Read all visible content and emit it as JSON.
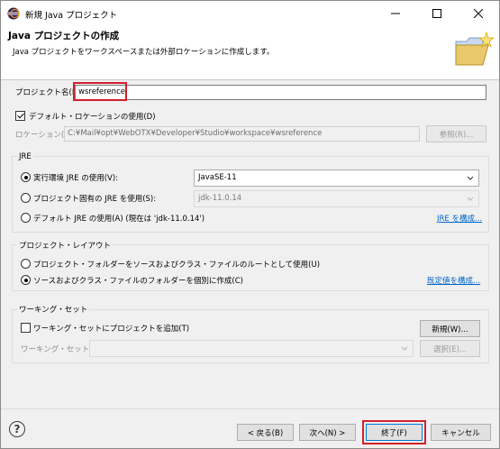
{
  "window": {
    "title": "新規 Java プロジェクト",
    "min_label": "—",
    "max_label": "☐",
    "close_label": "✕"
  },
  "header": {
    "title": "Java プロジェクトの作成",
    "description": "Java プロジェクトをワークスペースまたは外部ロケーションに作成します。"
  },
  "project": {
    "name_label": "プロジェクト名(P):",
    "name_value": "wsreference"
  },
  "location": {
    "default_label": "デフォルト・ロケーションの使用(D)",
    "default_checked": true,
    "location_label": "ロケーション(L):",
    "location_value": "C:¥Mail¥opt¥WebOTX¥Developer¥Studio¥workspace¥wsreference",
    "browse_label": "参照(R)..."
  },
  "jre": {
    "title": "JRE",
    "opt1_label": "実行環境 JRE の使用(V):",
    "opt1_value": "JavaSE-11",
    "opt2_label": "プロジェクト固有の JRE を使用(S):",
    "opt2_value": "jdk-11.0.14",
    "opt3_label": "デフォルト JRE の使用(A) (現在は 'jdk-11.0.14')",
    "configure_link": "JRE を構成...",
    "selected": 1
  },
  "layout": {
    "title": "プロジェクト・レイアウト",
    "opt1_label": "プロジェクト・フォルダーをソースおよびクラス・ファイルのルートとして使用(U)",
    "opt2_label": "ソースおよびクラス・ファイルのフォルダーを個別に作成(C)",
    "configure_link": "既定値を構成...",
    "selected": 2
  },
  "working_sets": {
    "title": "ワーキング・セット",
    "add_label": "ワーキング・セットにプロジェクトを追加(T)",
    "add_checked": false,
    "new_label": "新規(W)...",
    "sets_label": "ワーキング・セット(O):",
    "sets_value": "",
    "select_label": "選択(E)..."
  },
  "footer": {
    "help_label": "?",
    "back_label": "< 戻る(B)",
    "next_label": "次へ(N) >",
    "finish_label": "終了(F)",
    "cancel_label": "キャンセル"
  },
  "colors": {
    "highlight": "#d2202c",
    "link": "#0066cc"
  }
}
